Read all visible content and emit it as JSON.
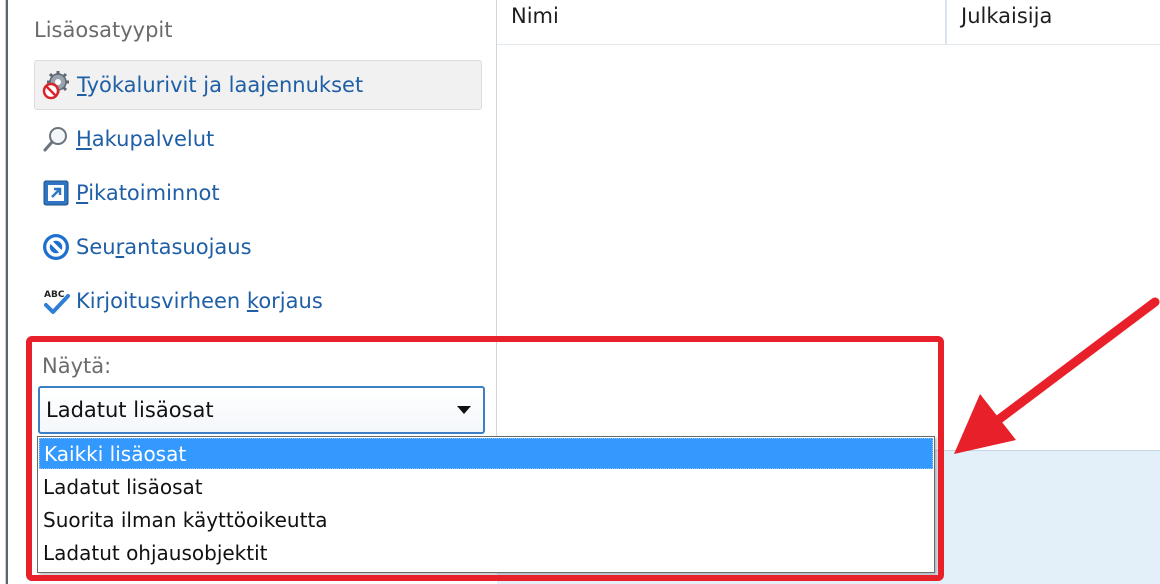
{
  "sidebar": {
    "section_title": "Lisäosatyypit",
    "items": [
      {
        "label_pre": "",
        "label_u": "T",
        "label_post": "yökalurivit ja laajennukset",
        "icon": "gear-toolbar-icon",
        "selected": true
      },
      {
        "label_pre": "",
        "label_u": "H",
        "label_post": "akupalvelut",
        "icon": "search-icon",
        "selected": false
      },
      {
        "label_pre": "",
        "label_u": "P",
        "label_post": "ikatoiminnot",
        "icon": "accelerator-icon",
        "selected": false
      },
      {
        "label_pre": "Seu",
        "label_u": "r",
        "label_post": "antasuojaus",
        "icon": "tracking-protection-icon",
        "selected": false
      },
      {
        "label_pre": "Kirjoitusvirheen ",
        "label_u": "k",
        "label_post": "orjaus",
        "icon": "spelling-check-icon",
        "selected": false
      }
    ]
  },
  "list": {
    "col_name": "Nimi",
    "col_publisher": "Julkaisija"
  },
  "show": {
    "label": "Näytä:",
    "selected_value": "Ladatut lisäosat",
    "options": [
      "Kaikki lisäosat",
      "Ladatut lisäosat",
      "Suorita ilman käyttöoikeutta",
      "Ladatut ohjausobjektit"
    ],
    "highlighted_index": 0
  },
  "colors": {
    "highlight_red": "#e8202a",
    "link_blue": "#1f5fa6",
    "option_hover": "#3399ff"
  }
}
